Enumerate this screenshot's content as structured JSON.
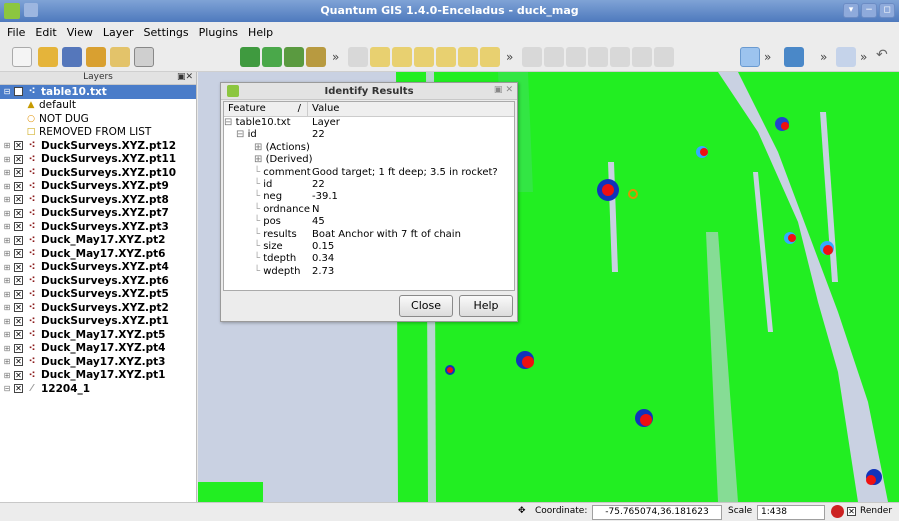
{
  "window": {
    "title": "Quantum GIS 1.4.0-Enceladus - duck_mag"
  },
  "menu": [
    "File",
    "Edit",
    "View",
    "Layer",
    "Settings",
    "Plugins",
    "Help"
  ],
  "layers_panel": {
    "title": "Layers",
    "selected_layer": "table10.txt",
    "symbols": [
      {
        "icon": "triangle",
        "label": "default",
        "color": "#e0b800"
      },
      {
        "icon": "circle",
        "label": "NOT DUG",
        "color": "#e09000"
      },
      {
        "icon": "square",
        "label": "REMOVED FROM LIST",
        "color": "#d4b000"
      }
    ],
    "layers": [
      "DuckSurveys.XYZ.pt12",
      "DuckSurveys.XYZ.pt11",
      "DuckSurveys.XYZ.pt10",
      "DuckSurveys.XYZ.pt9",
      "DuckSurveys.XYZ.pt8",
      "DuckSurveys.XYZ.pt7",
      "DuckSurveys.XYZ.pt3",
      "Duck_May17.XYZ.pt2",
      "Duck_May17.XYZ.pt6",
      "DuckSurveys.XYZ.pt4",
      "DuckSurveys.XYZ.pt6",
      "DuckSurveys.XYZ.pt5",
      "DuckSurveys.XYZ.pt2",
      "DuckSurveys.XYZ.pt1",
      "Duck_May17.XYZ.pt5",
      "Duck_May17.XYZ.pt4",
      "Duck_May17.XYZ.pt3",
      "Duck_May17.XYZ.pt1"
    ],
    "raster_layer": "12204_1"
  },
  "identify_dialog": {
    "title": "Identify Results",
    "col_feature": "Feature",
    "col_value": "Value",
    "layer_key": "table10.txt",
    "layer_val": "Layer",
    "id_key": "id",
    "id_val": "22",
    "actions": "(Actions)",
    "derived": "(Derived)",
    "attributes": [
      {
        "k": "comment",
        "v": "Good target; 1 ft deep; 3.5 in rocket?"
      },
      {
        "k": "id",
        "v": "22"
      },
      {
        "k": "neg",
        "v": "-39.1"
      },
      {
        "k": "ordnance",
        "v": "N"
      },
      {
        "k": "pos",
        "v": "45"
      },
      {
        "k": "results",
        "v": "Boat Anchor with 7 ft of chain"
      },
      {
        "k": "size",
        "v": "0.15"
      },
      {
        "k": "tdepth",
        "v": "0.34"
      },
      {
        "k": "wdepth",
        "v": "2.73"
      }
    ],
    "close_label": "Close",
    "help_label": "Help"
  },
  "status": {
    "coordinate_label": "Coordinate:",
    "coordinate_value": "-75.765074,36.181623",
    "scale_label": "Scale",
    "scale_value": "1:438",
    "render_label": "Render"
  },
  "colors": {
    "map_green": "#22ee22",
    "map_bg": "#c9d1e2",
    "selection": "#4a7cc9"
  }
}
